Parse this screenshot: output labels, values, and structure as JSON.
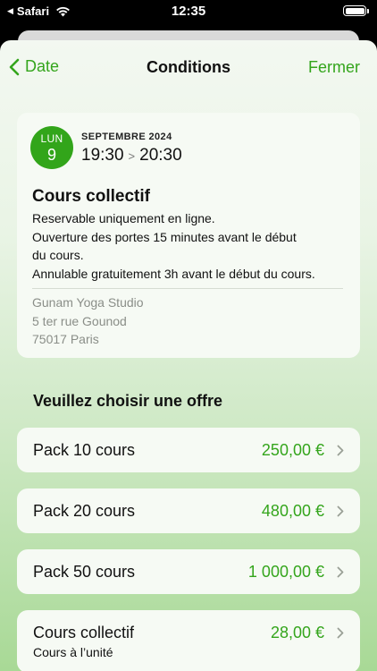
{
  "status": {
    "back_app": "Safari",
    "time": "12:35"
  },
  "nav": {
    "back_label": "Date",
    "title": "Conditions",
    "close_label": "Fermer"
  },
  "session": {
    "weekday": "LUN",
    "day": "9",
    "month": "SEPTEMBRE 2024",
    "start": "19:30",
    "end": "20:30",
    "title": "Cours collectif",
    "conditions": [
      "Reservable uniquement en ligne.",
      "Ouverture des portes 15 minutes avant le début",
      "du cours.",
      "Annulable gratuitement 3h avant le début du cours."
    ],
    "address": [
      "Gunam Yoga Studio",
      "5 ter rue Gounod",
      "75017 Paris"
    ]
  },
  "offers_title": "Veuillez choisir une offre",
  "offers": [
    {
      "label": "Pack 10 cours",
      "price": "250,00 €"
    },
    {
      "label": "Pack 20 cours",
      "price": "480,00 €"
    },
    {
      "label": "Pack 50 cours",
      "price": "1 000,00 €"
    },
    {
      "label": "Cours collectif",
      "price": "28,00 €",
      "subtitle": "Cours à l’unité"
    }
  ],
  "colors": {
    "accent": "#34a51c",
    "badge": "#32a51a"
  }
}
